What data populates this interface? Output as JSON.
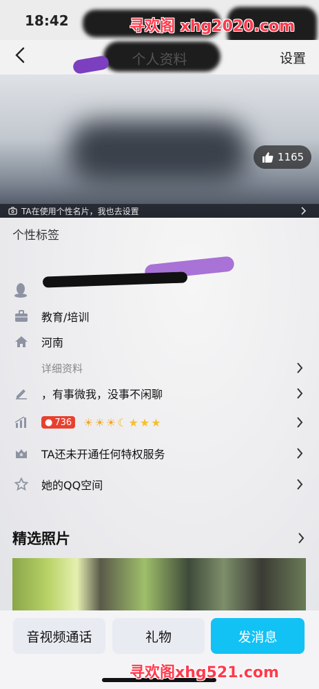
{
  "status": {
    "time": "18:42"
  },
  "watermark": {
    "top": "寻欢阁 xhg2020.com",
    "bottom": "寻欢阁xhg521.com"
  },
  "nav": {
    "title": "个人资料",
    "settings": "设置"
  },
  "cover": {
    "likes": "1165",
    "tip": "TA在使用个性名片，我也去设置"
  },
  "profile": {
    "tag_label": "个性标签",
    "rows": [
      {
        "icon": "briefcase-icon",
        "text": "教育/培训"
      },
      {
        "icon": "home-icon",
        "text": "河南"
      },
      {
        "icon": "",
        "text": "详细资料"
      },
      {
        "icon": "pencil-icon",
        "text": "，有事微我，没事不闲聊"
      },
      {
        "icon": "level-chart-icon",
        "text": "736"
      },
      {
        "icon": "crown-icon",
        "text": "TA还未开通任何特权服务"
      },
      {
        "icon": "star-icon",
        "text": "她的QQ空间"
      }
    ]
  },
  "photos": {
    "title": "精选照片"
  },
  "actions": {
    "call": "音视频通话",
    "gift": "礼物",
    "message": "发消息"
  },
  "colors": {
    "accent": "#12c2f5",
    "watermark": "#ff3a4c"
  }
}
